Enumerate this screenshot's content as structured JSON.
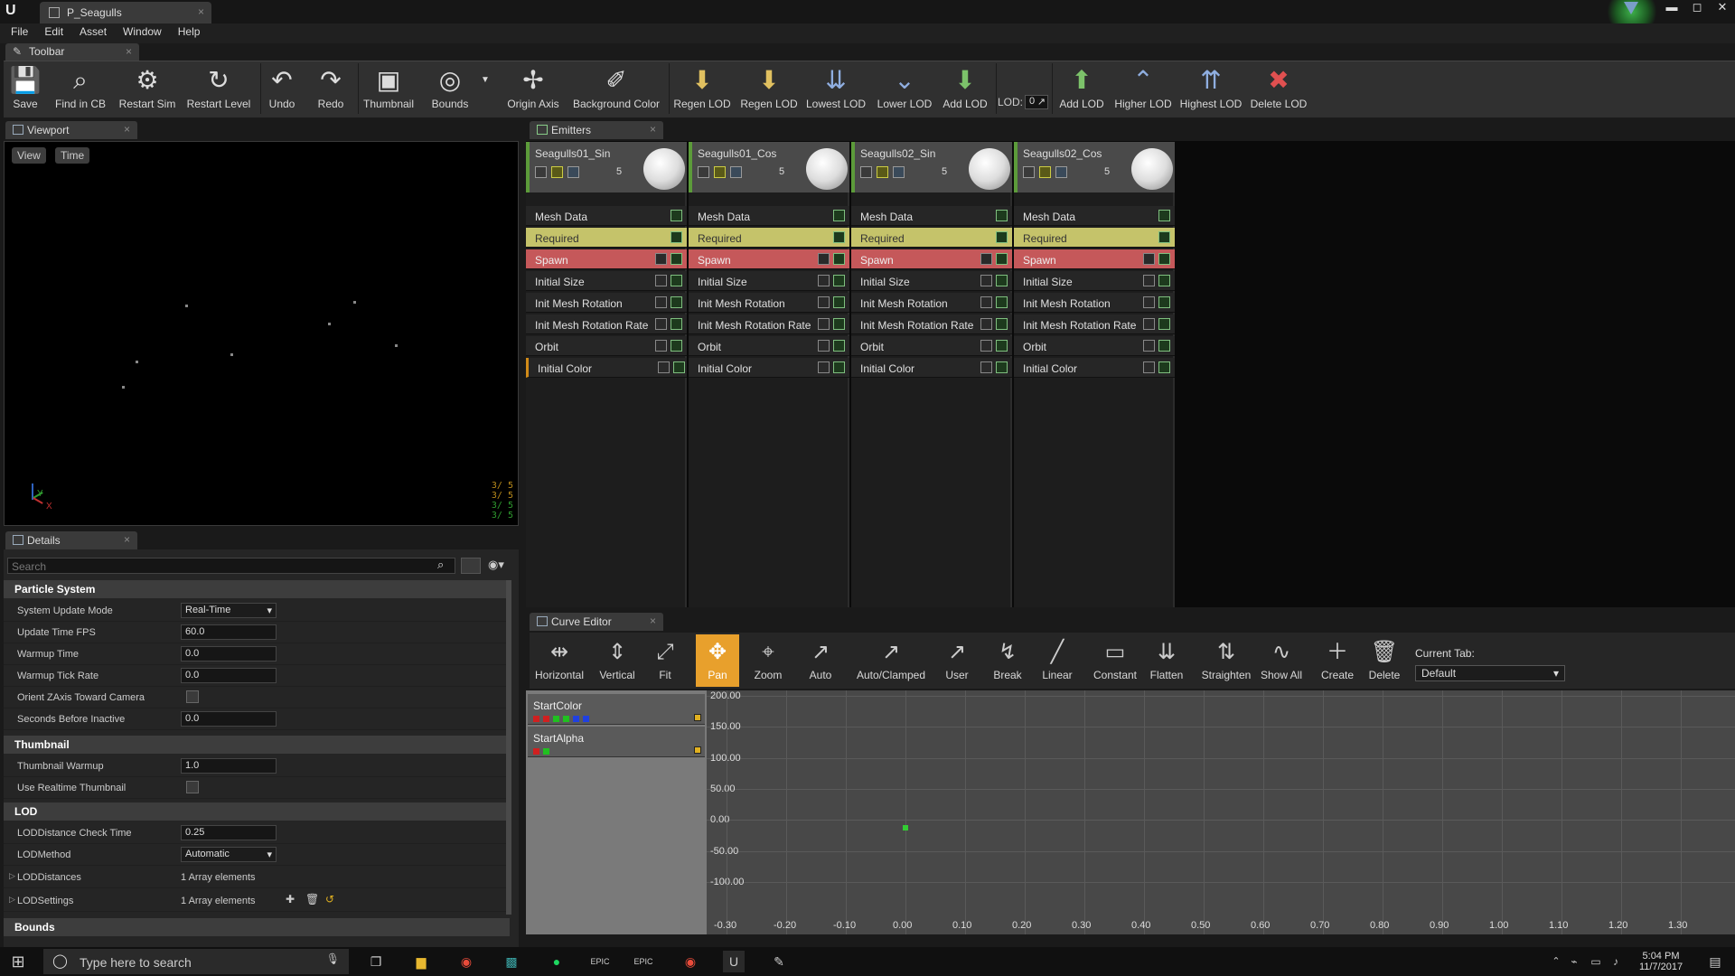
{
  "window": {
    "tab_title": "P_Seagulls",
    "buttons": [
      "▬",
      "◻",
      "✕"
    ]
  },
  "menu": [
    "File",
    "Edit",
    "Asset",
    "Window",
    "Help"
  ],
  "toolbar": {
    "tab_label": "Toolbar",
    "buttons": [
      {
        "label": "Save",
        "icon": "save-icon"
      },
      {
        "label": "Find in CB",
        "icon": "search-icon"
      },
      {
        "label": "Restart Sim",
        "icon": "restart-sim-icon"
      },
      {
        "label": "Restart Level",
        "icon": "restart-level-icon"
      },
      {
        "label": "Undo",
        "icon": "undo-icon"
      },
      {
        "label": "Redo",
        "icon": "redo-icon"
      },
      {
        "label": "Thumbnail",
        "icon": "thumbnail-icon"
      },
      {
        "label": "Bounds",
        "icon": "bounds-icon"
      },
      {
        "label": "Origin Axis",
        "icon": "origin-axis-icon"
      },
      {
        "label": "Background Color",
        "icon": "background-color-icon"
      },
      {
        "label": "Regen LOD",
        "icon": "regen-lod-icon"
      },
      {
        "label": "Regen LOD",
        "icon": "regen-lod-2-icon"
      },
      {
        "label": "Lowest LOD",
        "icon": "lowest-lod-icon"
      },
      {
        "label": "Lower LOD",
        "icon": "lower-lod-icon"
      },
      {
        "label": "Add LOD",
        "icon": "add-lod-icon"
      },
      {
        "label": "Add LOD",
        "icon": "add-lod-2-icon"
      },
      {
        "label": "Higher LOD",
        "icon": "higher-lod-icon"
      },
      {
        "label": "Highest LOD",
        "icon": "highest-lod-icon"
      },
      {
        "label": "Delete LOD",
        "icon": "delete-lod-icon"
      }
    ],
    "lod_label": "LOD:",
    "lod_value": "0"
  },
  "viewport": {
    "tab_label": "Viewport",
    "view_btn": "View",
    "time_btn": "Time",
    "stats": [
      "3/  5",
      "3/  5",
      "3/  5",
      "3/  5"
    ],
    "axis_y": "Y",
    "axis_x": "X"
  },
  "emitters": {
    "tab_label": "Emitters",
    "columns": [
      {
        "name": "Seagulls01_Sin",
        "count": "5"
      },
      {
        "name": "Seagulls01_Cos",
        "count": "5"
      },
      {
        "name": "Seagulls02_Sin",
        "count": "5"
      },
      {
        "name": "Seagulls02_Cos",
        "count": "5"
      }
    ],
    "modules": [
      "Mesh Data",
      "Required",
      "Spawn",
      "Initial Size",
      "Init Mesh Rotation",
      "Init Mesh Rotation Rate",
      "Orbit",
      "Initial Color"
    ]
  },
  "details": {
    "tab_label": "Details",
    "search_placeholder": "Search",
    "sections": {
      "particle_system": "Particle System",
      "thumbnail": "Thumbnail",
      "lod": "LOD",
      "bounds": "Bounds"
    },
    "rows": {
      "system_update_mode": {
        "label": "System Update Mode",
        "value": "Real-Time"
      },
      "update_time_fps": {
        "label": "Update Time FPS",
        "value": "60.0"
      },
      "warmup_time": {
        "label": "Warmup Time",
        "value": "0.0"
      },
      "warmup_tick_rate": {
        "label": "Warmup Tick Rate",
        "value": "0.0"
      },
      "orient_z": {
        "label": "Orient ZAxis Toward Camera"
      },
      "seconds_before_inactive": {
        "label": "Seconds Before Inactive",
        "value": "0.0"
      },
      "thumbnail_warmup": {
        "label": "Thumbnail Warmup",
        "value": "1.0"
      },
      "use_realtime_thumbnail": {
        "label": "Use Realtime Thumbnail"
      },
      "lod_distance_check": {
        "label": "LODDistance Check Time",
        "value": "0.25"
      },
      "lod_method": {
        "label": "LODMethod",
        "value": "Automatic"
      },
      "lod_distances": {
        "label": "LODDistances",
        "value": "1 Array elements"
      },
      "lod_settings": {
        "label": "LODSettings",
        "value": "1 Array elements"
      }
    }
  },
  "curve_editor": {
    "tab_label": "Curve Editor",
    "buttons": [
      {
        "label": "Horizontal",
        "icon": "horizontal-fit-icon"
      },
      {
        "label": "Vertical",
        "icon": "vertical-fit-icon"
      },
      {
        "label": "Fit",
        "icon": "fit-icon"
      },
      {
        "label": "Pan",
        "icon": "pan-icon"
      },
      {
        "label": "Zoom",
        "icon": "zoom-icon"
      },
      {
        "label": "Auto",
        "icon": "auto-tangent-icon"
      },
      {
        "label": "Auto/Clamped",
        "icon": "auto-clamped-icon"
      },
      {
        "label": "User",
        "icon": "user-tangent-icon"
      },
      {
        "label": "Break",
        "icon": "break-tangent-icon"
      },
      {
        "label": "Linear",
        "icon": "linear-icon"
      },
      {
        "label": "Constant",
        "icon": "constant-icon"
      },
      {
        "label": "Flatten",
        "icon": "flatten-icon"
      },
      {
        "label": "Straighten",
        "icon": "straighten-icon"
      },
      {
        "label": "Show All",
        "icon": "show-all-icon"
      },
      {
        "label": "Create",
        "icon": "create-icon"
      },
      {
        "label": "Delete",
        "icon": "delete-icon"
      }
    ],
    "current_tab_label": "Current Tab:",
    "current_tab_value": "Default",
    "tracks": [
      "StartColor",
      "StartAlpha"
    ],
    "y_labels": [
      "200.00",
      "150.00",
      "100.00",
      "50.00",
      "0.00",
      "-50.00",
      "-100.00"
    ],
    "x_labels": [
      "-0.30",
      "-0.20",
      "-0.10",
      "0.00",
      "0.10",
      "0.20",
      "0.30",
      "0.40",
      "0.50",
      "0.60",
      "0.70",
      "0.80",
      "0.90",
      "1.00",
      "1.10",
      "1.20",
      "1.30"
    ]
  },
  "taskbar": {
    "search_placeholder": "Type here to search",
    "time": "5:04 PM",
    "date": "11/7/2017"
  }
}
